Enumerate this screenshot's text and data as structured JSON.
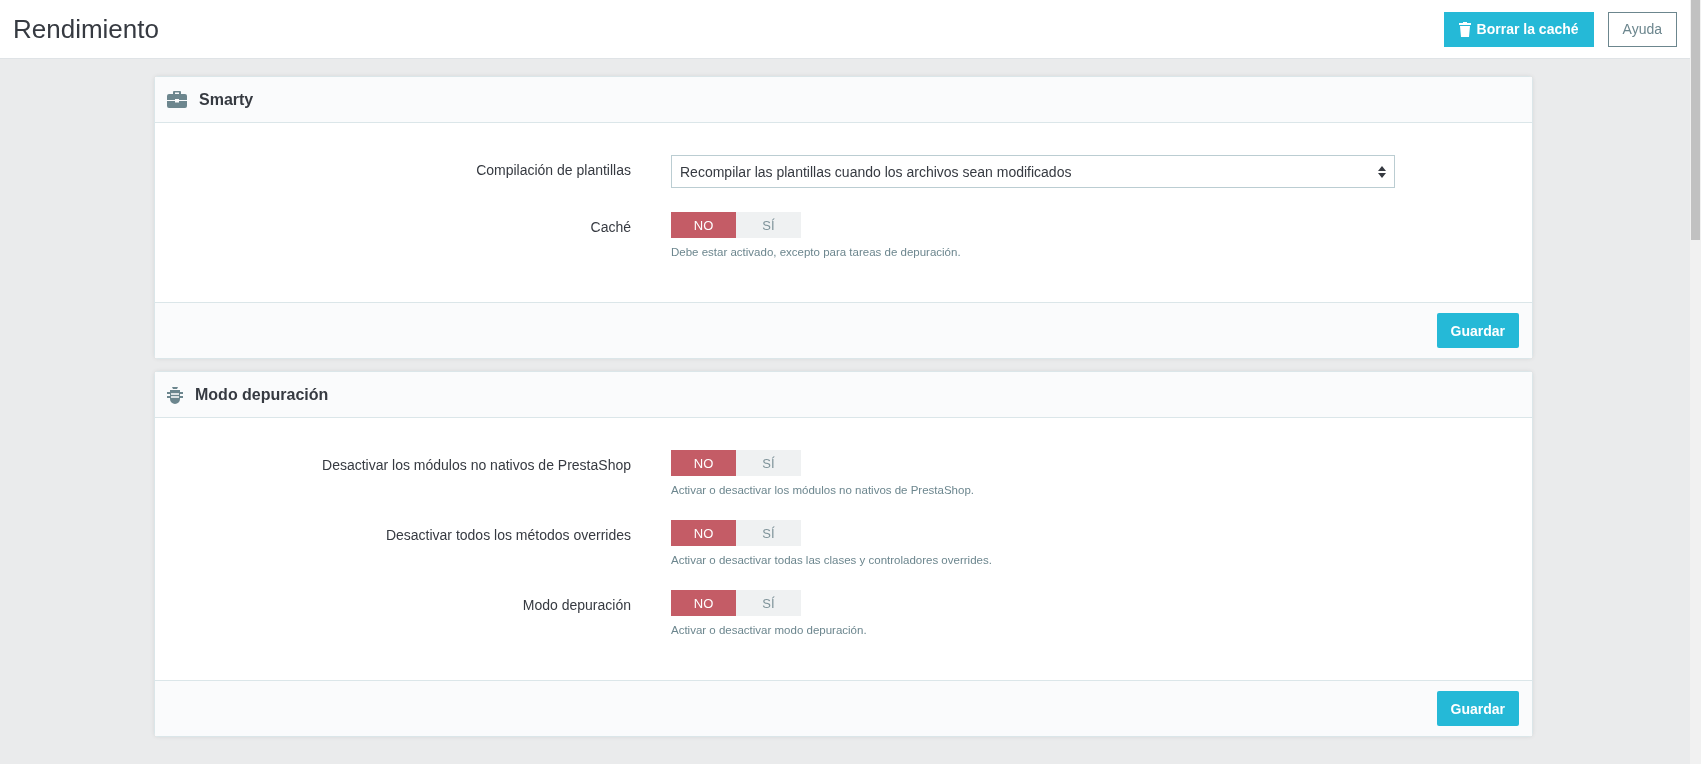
{
  "header": {
    "title": "Rendimiento",
    "buttons": [
      {
        "label": "Borrar la caché",
        "kind": "primary"
      },
      {
        "label": "Ayuda",
        "kind": "outline"
      }
    ]
  },
  "panels": [
    {
      "title": "Smarty",
      "fields": [
        {
          "kind": "select",
          "label": "Compilación de plantillas",
          "value": "Recompilar las plantillas cuando los archivos sean modificados"
        },
        {
          "kind": "toggle",
          "label": "Caché",
          "options": [
            {
              "label": "NO",
              "selected": true
            },
            {
              "label": "SÍ",
              "selected": false
            }
          ],
          "help": "Debe estar activado, excepto para tareas de depuración."
        }
      ],
      "save": "Guardar"
    },
    {
      "title": "Modo depuración",
      "fields": [
        {
          "kind": "toggle",
          "label": "Desactivar los módulos no nativos de PrestaShop",
          "options": [
            {
              "label": "NO",
              "selected": true
            },
            {
              "label": "SÍ",
              "selected": false
            }
          ],
          "help": "Activar o desactivar los módulos no nativos de PrestaShop."
        },
        {
          "kind": "toggle",
          "label": "Desactivar todos los métodos overrides",
          "options": [
            {
              "label": "NO",
              "selected": true
            },
            {
              "label": "SÍ",
              "selected": false
            }
          ],
          "help": "Activar o desactivar todas las clases y controladores overrides."
        },
        {
          "kind": "toggle",
          "label": "Modo depuración",
          "options": [
            {
              "label": "NO",
              "selected": true
            },
            {
              "label": "SÍ",
              "selected": false
            }
          ],
          "help": "Activar o desactivar modo depuración."
        }
      ],
      "save": "Guardar"
    }
  ]
}
